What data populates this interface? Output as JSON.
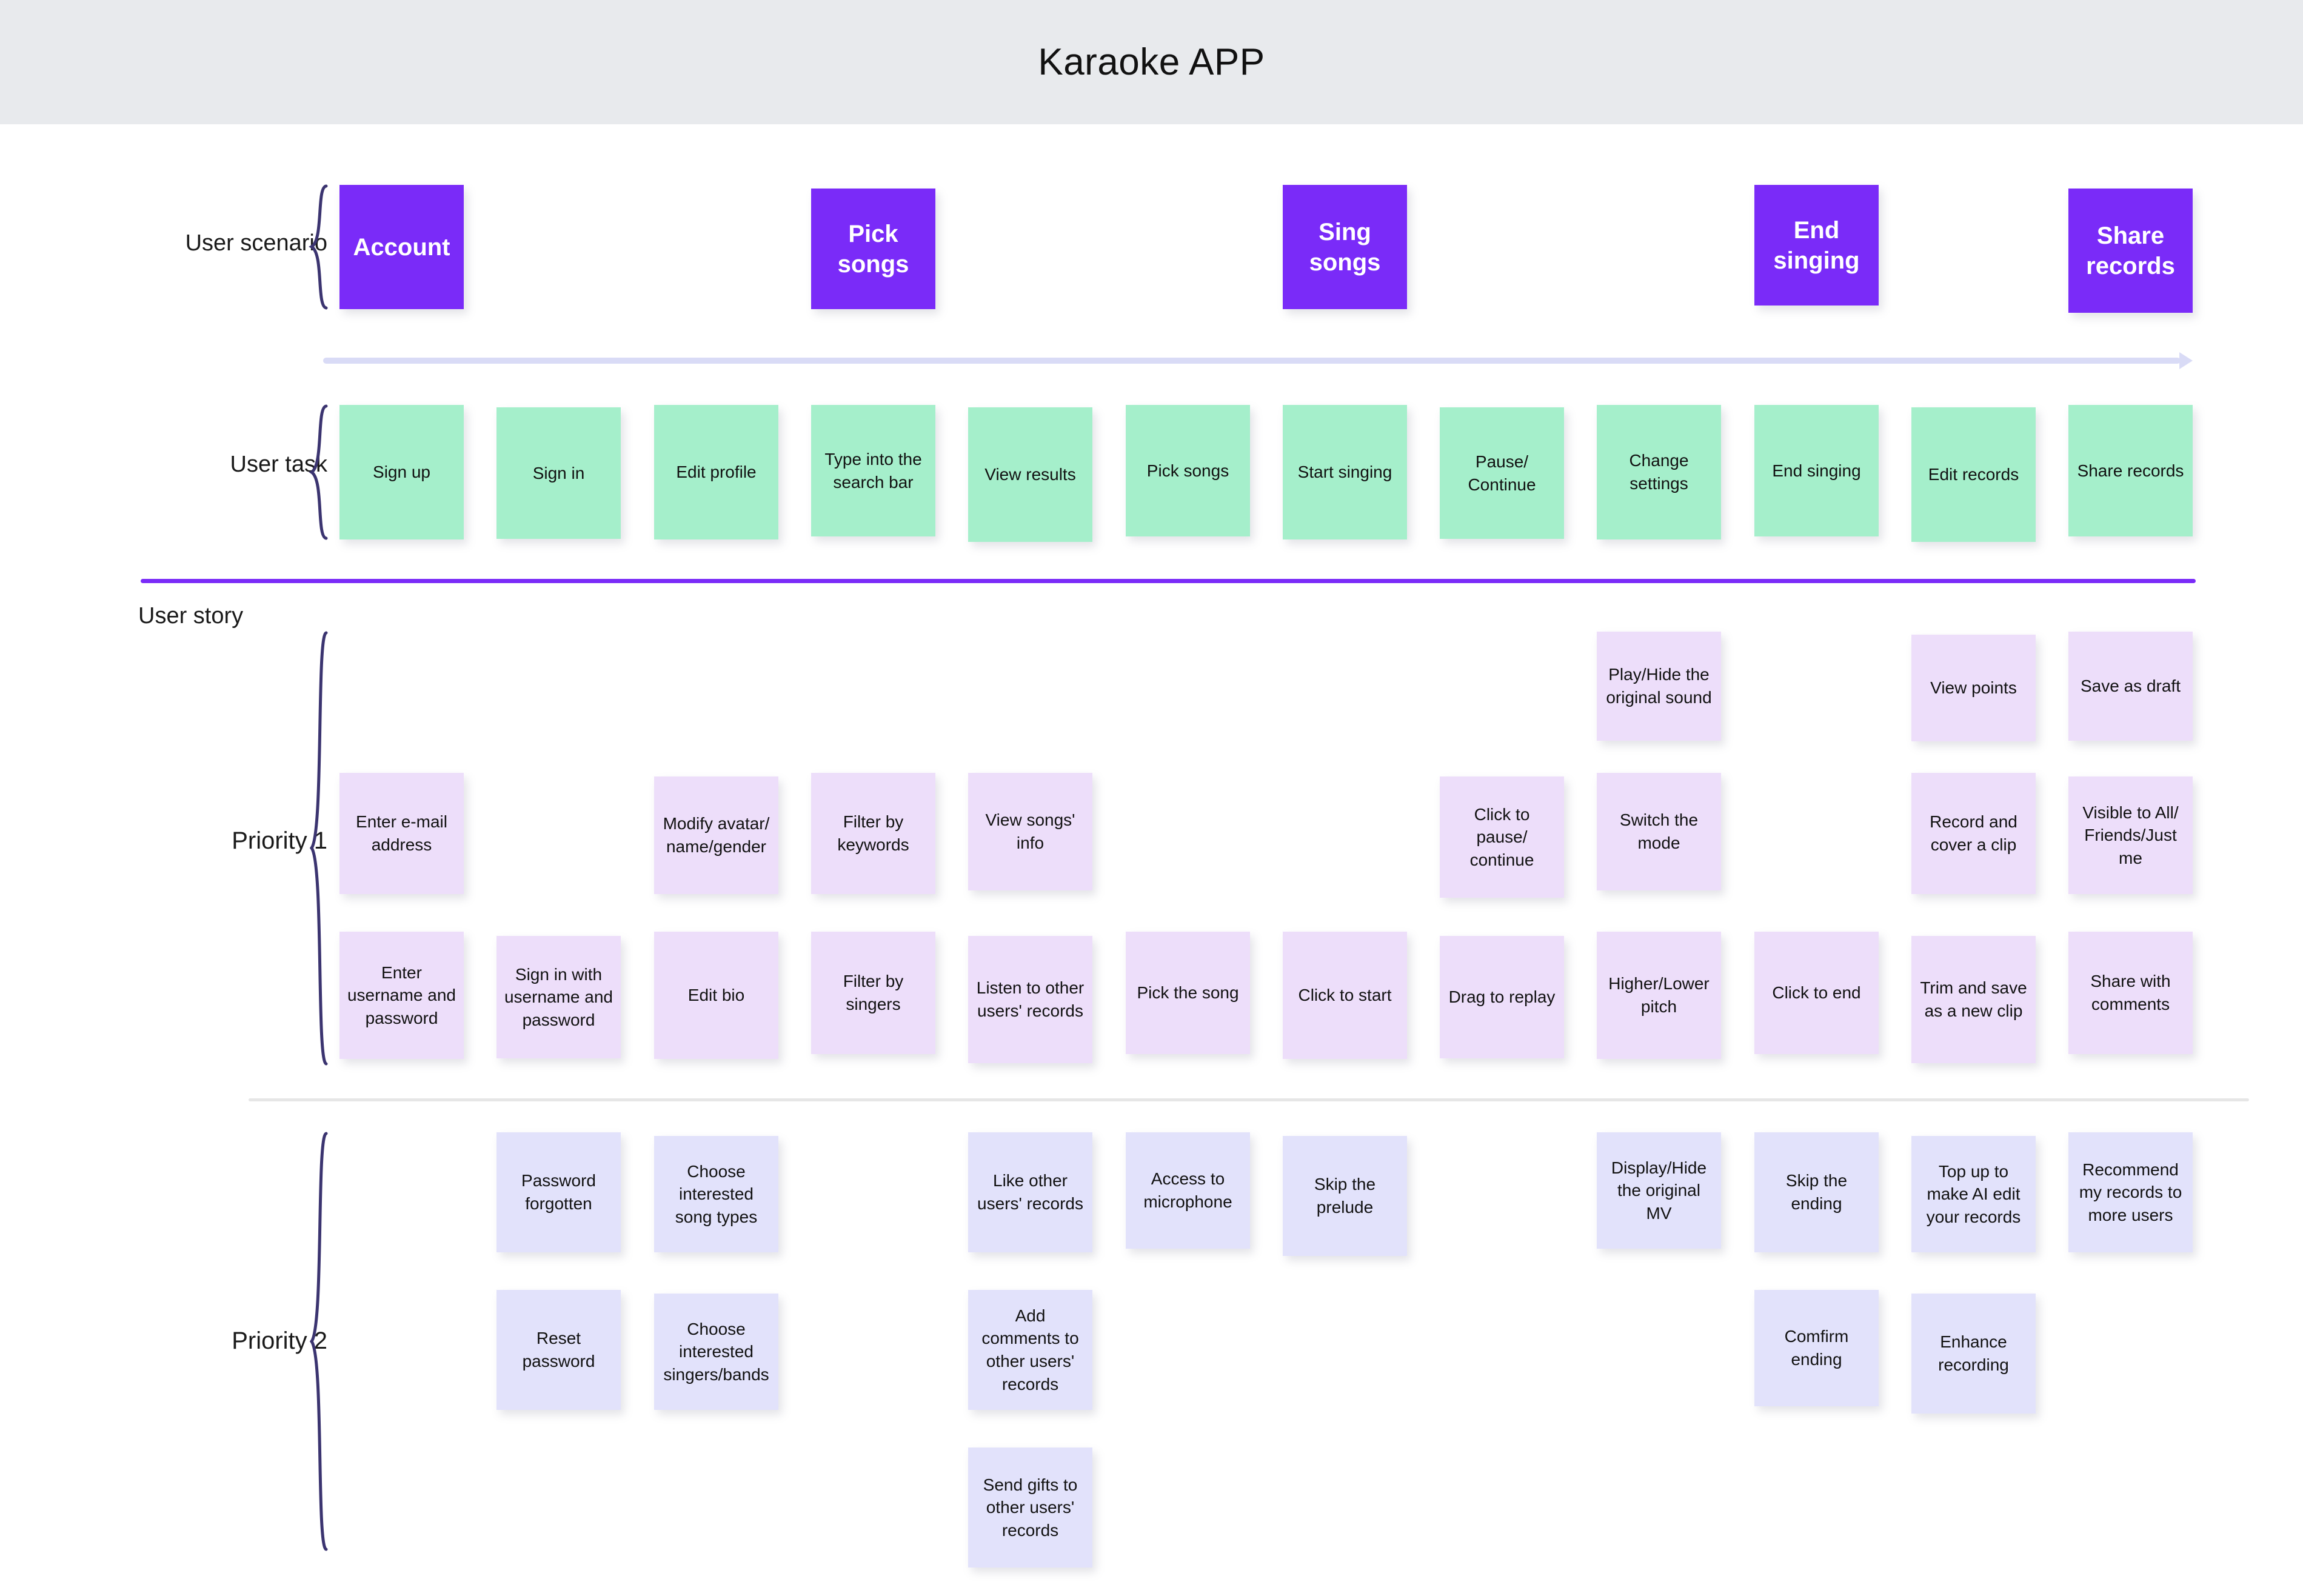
{
  "header": {
    "title": "Karaoke APP"
  },
  "colors": {
    "header_bg": "#e8eaed",
    "scenario": "#7a2bf8",
    "task": "#a5efcb",
    "story_p1": "#eddefa",
    "story_p2": "#e2e2fb",
    "rule_purple": "#7a2bf8",
    "rule_gray": "#e6e6e6",
    "arrow": "#d9dbf6",
    "brace": "#3b3470"
  },
  "labels": {
    "user_scenario": "User scenario",
    "user_task": "User task",
    "user_story": "User story",
    "priority_1": "Priority 1",
    "priority_2": "Priority 2"
  },
  "scenarios": [
    {
      "col": 1,
      "label": "Account"
    },
    {
      "col": 4,
      "label": "Pick\nsongs"
    },
    {
      "col": 7,
      "label": "Sing\nsongs"
    },
    {
      "col": 10,
      "label": "End\nsinging"
    },
    {
      "col": 12,
      "label": "Share\nrecords"
    }
  ],
  "tasks": [
    {
      "col": 1,
      "label": "Sign up"
    },
    {
      "col": 2,
      "label": "Sign in"
    },
    {
      "col": 3,
      "label": "Edit profile"
    },
    {
      "col": 4,
      "label": "Type into the\nsearch bar"
    },
    {
      "col": 5,
      "label": "View results"
    },
    {
      "col": 6,
      "label": "Pick songs"
    },
    {
      "col": 7,
      "label": "Start singing"
    },
    {
      "col": 8,
      "label": "Pause/\nContinue"
    },
    {
      "col": 9,
      "label": "Change\nsettings"
    },
    {
      "col": 10,
      "label": "End singing"
    },
    {
      "col": 11,
      "label": "Edit records"
    },
    {
      "col": 12,
      "label": "Share records"
    }
  ],
  "priority_1": {
    "row_1": [
      {
        "col": 9,
        "label": "Play/Hide the\noriginal sound"
      },
      {
        "col": 11,
        "label": "View points"
      },
      {
        "col": 12,
        "label": "Save as draft"
      }
    ],
    "row_2": [
      {
        "col": 1,
        "label": "Enter e-mail\naddress"
      },
      {
        "col": 3,
        "label": "Modify avatar/\nname/gender"
      },
      {
        "col": 4,
        "label": "Filter by\nkeywords"
      },
      {
        "col": 5,
        "label": "View songs'\ninfo"
      },
      {
        "col": 8,
        "label": "Click to\npause/\ncontinue"
      },
      {
        "col": 9,
        "label": "Switch the\nmode"
      },
      {
        "col": 11,
        "label": "Record and\ncover a clip"
      },
      {
        "col": 12,
        "label": "Visible to All/\nFriends/Just\nme"
      }
    ],
    "row_3": [
      {
        "col": 1,
        "label": "Enter\nusername and\npassword"
      },
      {
        "col": 2,
        "label": "Sign in with\nusername and\npassword"
      },
      {
        "col": 3,
        "label": "Edit bio"
      },
      {
        "col": 4,
        "label": "Filter by\nsingers"
      },
      {
        "col": 5,
        "label": "Listen to other\nusers' records"
      },
      {
        "col": 6,
        "label": "Pick the song"
      },
      {
        "col": 7,
        "label": "Click to start"
      },
      {
        "col": 8,
        "label": "Drag to replay"
      },
      {
        "col": 9,
        "label": "Higher/Lower\npitch"
      },
      {
        "col": 10,
        "label": "Click to end"
      },
      {
        "col": 11,
        "label": "Trim and save\nas a new clip"
      },
      {
        "col": 12,
        "label": "Share with\ncomments"
      }
    ]
  },
  "priority_2": {
    "row_1": [
      {
        "col": 2,
        "label": "Password\nforgotten"
      },
      {
        "col": 3,
        "label": "Choose\ninterested\nsong types"
      },
      {
        "col": 5,
        "label": "Like other\nusers' records"
      },
      {
        "col": 6,
        "label": "Access to\nmicrophone"
      },
      {
        "col": 7,
        "label": "Skip the\nprelude"
      },
      {
        "col": 9,
        "label": "Display/Hide\nthe original\nMV"
      },
      {
        "col": 10,
        "label": "Skip the\nending"
      },
      {
        "col": 11,
        "label": "Top up to\nmake AI edit\nyour records"
      },
      {
        "col": 12,
        "label": "Recommend\nmy records to\nmore users"
      }
    ],
    "row_2": [
      {
        "col": 2,
        "label": "Reset\npassword"
      },
      {
        "col": 3,
        "label": "Choose\ninterested\nsingers/bands"
      },
      {
        "col": 5,
        "label": "Add\ncomments to\nother users'\nrecords"
      },
      {
        "col": 10,
        "label": "Comfirm\nending"
      },
      {
        "col": 11,
        "label": "Enhance\nrecording"
      }
    ],
    "row_3": [
      {
        "col": 5,
        "label": "Send gifts to\nother users'\nrecords"
      }
    ]
  }
}
